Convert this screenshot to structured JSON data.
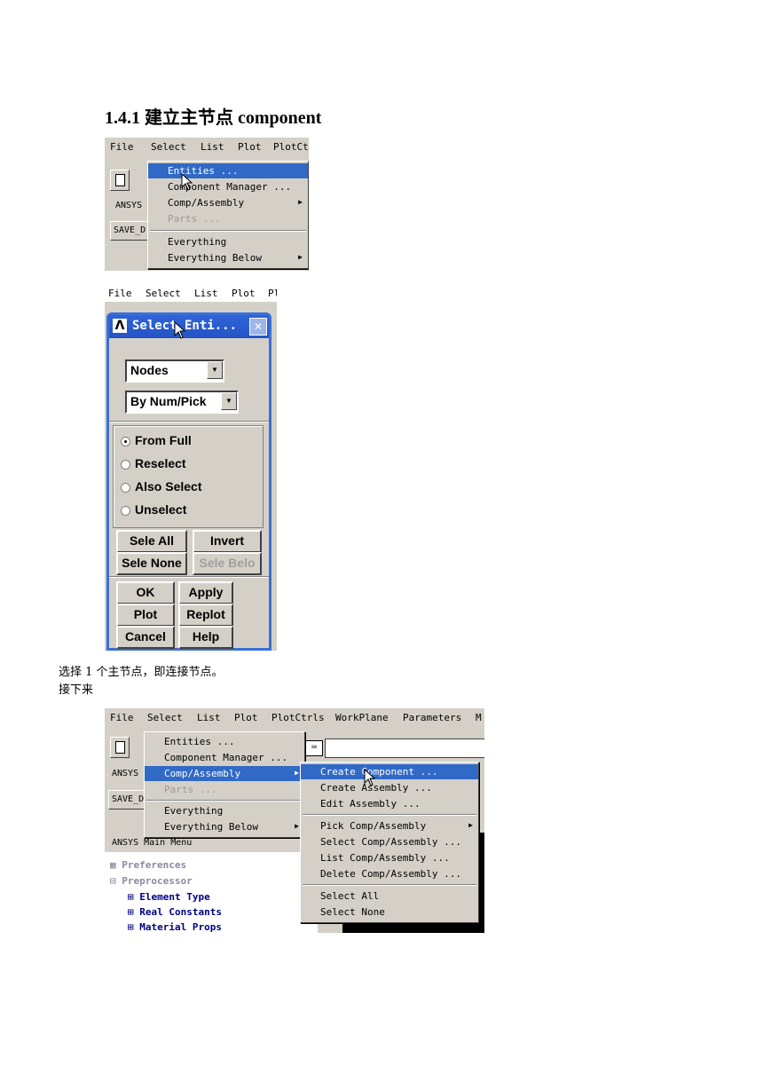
{
  "heading": "1.4.1 建立主节点 component",
  "shot1": {
    "menubar": [
      "File",
      "Select",
      "List",
      "Plot",
      "PlotCt"
    ],
    "left_labels": [
      "ANSYS",
      "SAVE_D"
    ],
    "menu": [
      {
        "label": "Entities ...",
        "state": "selected"
      },
      {
        "label": "Component Manager ...",
        "state": "normal"
      },
      {
        "label": "Comp/Assembly",
        "state": "normal",
        "submenu": true
      },
      {
        "label": "Parts ...",
        "state": "disabled"
      },
      {
        "label": "Everything",
        "state": "normal"
      },
      {
        "label": "Everything Below",
        "state": "normal",
        "submenu": true
      }
    ]
  },
  "shot2": {
    "menubar": [
      "File",
      "Select",
      "List",
      "Plot",
      "Pl"
    ],
    "title": "Select Enti...",
    "entity_type": "Nodes",
    "method": "By Num/Pick",
    "radios": [
      {
        "label": "From Full",
        "checked": true
      },
      {
        "label": "Reselect",
        "checked": false
      },
      {
        "label": "Also Select",
        "checked": false
      },
      {
        "label": "Unselect",
        "checked": false
      }
    ],
    "buttons": {
      "sele_all": "Sele All",
      "invert": "Invert",
      "sele_none": "Sele None",
      "sele_belo": "Sele Belo",
      "ok": "OK",
      "apply": "Apply",
      "plot": "Plot",
      "replot": "Replot",
      "cancel": "Cancel",
      "help": "Help"
    }
  },
  "caption1": "选择 1 个主节点，即连接节点。",
  "caption2": "接下来",
  "shot3": {
    "menubar": [
      "File",
      "Select",
      "List",
      "Plot",
      "PlotCtrls",
      "WorkPlane",
      "Parameters",
      "M"
    ],
    "left_labels": [
      "ANSYS",
      "SAVE_D"
    ],
    "main_menu_title": "ANSYS Main Menu",
    "menu": [
      {
        "label": "Entities ...",
        "state": "normal"
      },
      {
        "label": "Component Manager ...",
        "state": "normal"
      },
      {
        "label": "Comp/Assembly",
        "state": "selected",
        "submenu": true
      },
      {
        "label": "Parts ...",
        "state": "disabled"
      },
      {
        "label": "Everything",
        "state": "normal"
      },
      {
        "label": "Everything Below",
        "state": "normal",
        "submenu": true
      }
    ],
    "submenu": [
      {
        "label": "Create Component ...",
        "state": "selected"
      },
      {
        "label": "Create Assembly ...",
        "state": "normal"
      },
      {
        "label": "Edit Assembly ...",
        "state": "normal"
      },
      {
        "label": "Pick Comp/Assembly",
        "state": "normal",
        "submenu": true
      },
      {
        "label": "Select Comp/Assembly ...",
        "state": "normal"
      },
      {
        "label": "List Comp/Assembly ...",
        "state": "normal"
      },
      {
        "label": "Delete Comp/Assembly ...",
        "state": "normal"
      },
      {
        "label": "Select All",
        "state": "normal"
      },
      {
        "label": "Select None",
        "state": "normal"
      }
    ],
    "tree": [
      "Preferences",
      "Preprocessor",
      "Element Type",
      "Real Constants",
      "Material Props"
    ]
  }
}
